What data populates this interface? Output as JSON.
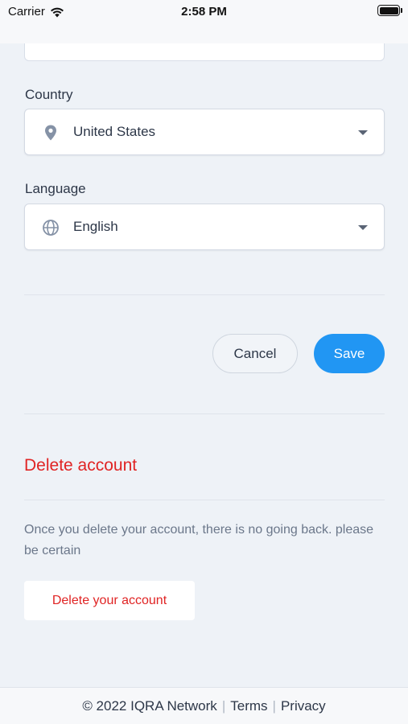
{
  "status_bar": {
    "carrier": "Carrier",
    "time": "2:58 PM"
  },
  "form": {
    "country": {
      "label": "Country",
      "value": "United States",
      "icon": "map-pin-icon"
    },
    "language": {
      "label": "Language",
      "value": "English",
      "icon": "globe-icon"
    }
  },
  "actions": {
    "cancel_label": "Cancel",
    "save_label": "Save"
  },
  "delete_section": {
    "heading": "Delete account",
    "description": "Once you delete your account, there is no going back. please be certain",
    "button_label": "Delete your account"
  },
  "footer": {
    "copyright": "© 2022 IQRA Network",
    "separator": "|",
    "terms": "Terms",
    "privacy": "Privacy"
  },
  "colors": {
    "accent": "#2196f3",
    "danger": "#e02424",
    "background": "#eef2f7"
  }
}
